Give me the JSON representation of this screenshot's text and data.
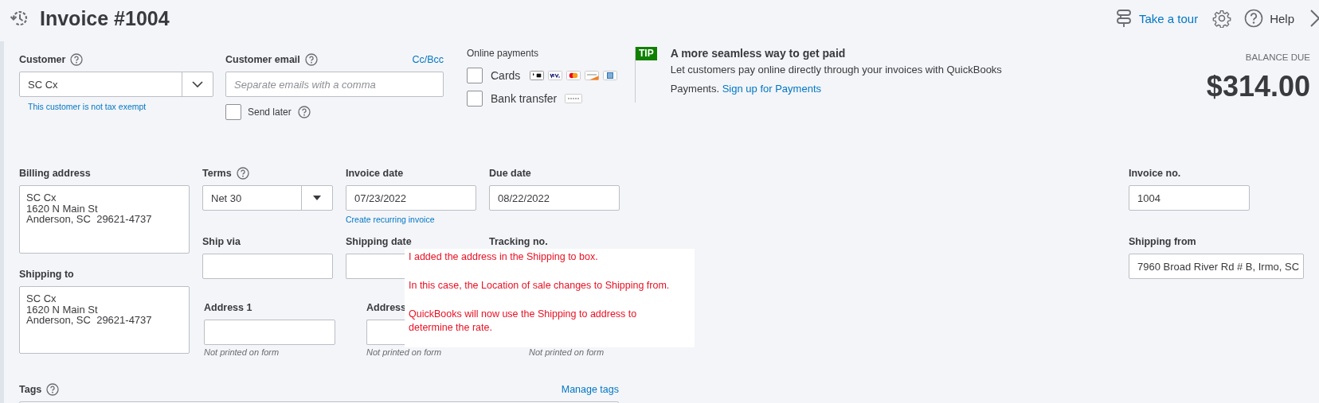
{
  "header": {
    "title": "Invoice #1004",
    "tour": "Take a tour",
    "help": "Help"
  },
  "customer": {
    "label": "Customer",
    "value": "SC Cx",
    "note": "This customer is not tax exempt"
  },
  "email": {
    "label": "Customer email",
    "link": "Cc/Bcc",
    "placeholder": "Separate emails with a comma",
    "send_later": {
      "label": "Send later",
      "checked": false
    }
  },
  "online_payments": {
    "label": "Online payments",
    "options": [
      {
        "label": "Cards",
        "checked": false,
        "kind": "cards"
      },
      {
        "label": "Bank transfer",
        "checked": false,
        "kind": "bank"
      }
    ]
  },
  "tip": {
    "badge": "TIP",
    "title": "A more seamless way to get paid",
    "text": "Let customers pay online directly through your invoices with QuickBooks Payments.",
    "link": "Sign up for Payments"
  },
  "balance": {
    "label": "BALANCE DUE",
    "amount": "$314.00"
  },
  "billing_address": {
    "label": "Billing address",
    "lines": [
      "SC Cx",
      "1620 N Main St",
      "Anderson, SC  29621-4737"
    ]
  },
  "shipping_to": {
    "label": "Shipping to",
    "lines": [
      "SC Cx",
      "1620 N Main St",
      "Anderson, SC  29621-4737"
    ]
  },
  "terms": {
    "label": "Terms",
    "value": "Net 30"
  },
  "invoice_date": {
    "label": "Invoice date",
    "value": "07/23/2022",
    "link": "Create recurring invoice"
  },
  "due_date": {
    "label": "Due date",
    "value": "08/22/2022"
  },
  "ship_via": {
    "label": "Ship via"
  },
  "shipping_date": {
    "label": "Shipping date"
  },
  "tracking_no": {
    "label": "Tracking no."
  },
  "address_fields": [
    {
      "label": "Address 1",
      "hint": "Not printed on form"
    },
    {
      "label": "Address",
      "hint": "Not printed on form"
    },
    {
      "hint": "Not printed on form"
    }
  ],
  "invoice_no": {
    "label": "Invoice no.",
    "value": "1004"
  },
  "shipping_from": {
    "label": "Shipping from",
    "value": "7960 Broad River Rd # B, Irmo, SC"
  },
  "tags": {
    "label": "Tags",
    "link": "Manage tags"
  },
  "annotation": {
    "paragraphs": [
      "I added the address in the Shipping to box.",
      "In this case, the Location of sale changes to Shipping from.",
      "QuickBooks will now use the Shipping to address to determine the rate."
    ]
  }
}
